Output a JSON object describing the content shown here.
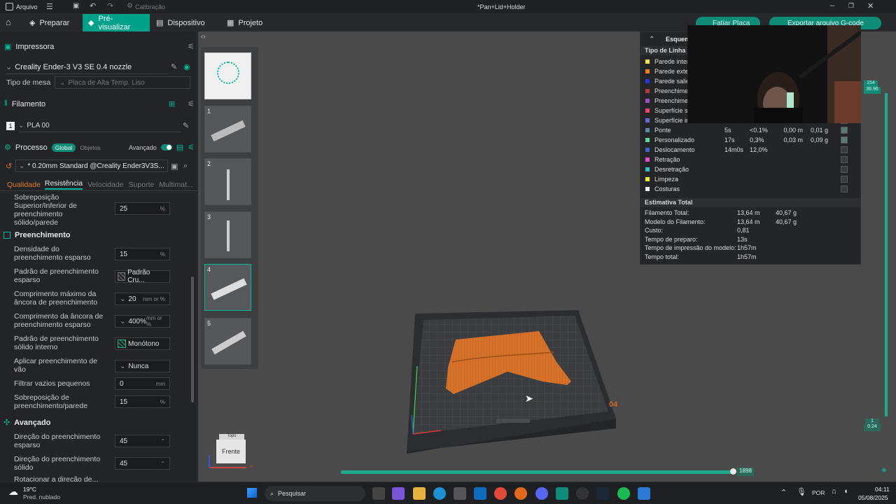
{
  "titlebar": {
    "file_menu": "Arquivo",
    "calibration": "Calibração",
    "doc_title": "*Pan+Lid+Holder"
  },
  "tabs": {
    "prepare": "Preparar",
    "preview": "Pré-visualizar",
    "device": "Dispositivo",
    "project": "Projeto",
    "slice": "Fatiar Placa",
    "export": "Exportar arquivo G-code"
  },
  "printer": {
    "section": "Impressora",
    "name": "Creality Ender-3 V3 SE 0.4 nozzle",
    "bed_label": "Tipo de mesa",
    "bed_value": "Placa de Alta Temp. Liso"
  },
  "filament": {
    "section": "Filamento",
    "slot": "1",
    "name": "PLA 00"
  },
  "process": {
    "section": "Processo",
    "global_tab": "Global",
    "objects_tab": "Objetos",
    "advanced_label": "Avançado",
    "profile": "* 0.20mm Standard @Creality Ender3V3S...",
    "subtabs": [
      "Qualidade",
      "Resistência",
      "Velocidade",
      "Suporte",
      "Multimat..."
    ]
  },
  "settings": {
    "overlap_label": "Sobreposição Superior/Inferior de preenchimento sólido/parede",
    "overlap_value": "25",
    "overlap_unit": "%",
    "infill_section": "Preenchimento",
    "density_label": "Densidade do preenchimento esparso",
    "density_value": "15",
    "density_unit": "%",
    "sparse_pattern_label": "Padrão de preenchimento esparso",
    "sparse_pattern_value": "Padrão Cru...",
    "anchor_max_label": "Comprimento máximo da âncora de preenchimento",
    "anchor_max_value": "20",
    "anchor_max_unit": "mm or %",
    "anchor_len_label": "Comprimento da âncora de preenchimento esparso",
    "anchor_len_value": "400%",
    "anchor_len_unit": "mm or %",
    "solid_pattern_label": "Padrão de preenchimento sólido interno",
    "solid_pattern_value": "Monótono",
    "apply_gap_label": "Aplicar preenchimento de vão",
    "apply_gap_value": "Nunca",
    "filter_label": "Filtrar vazios pequenos",
    "filter_value": "0",
    "filter_unit": "mm",
    "wall_overlap_label": "Sobreposição de preenchimento/parede",
    "wall_overlap_value": "15",
    "wall_overlap_unit": "%",
    "advanced_section": "Avançado",
    "sparse_dir_label": "Direção do preenchimento esparso",
    "sparse_dir_value": "45",
    "solid_dir_label": "Direção do preenchimento sólido",
    "solid_dir_value": "45",
    "cut_label": "Rotacionar a direção de..."
  },
  "plates": [
    "1",
    "2",
    "3",
    "4",
    "5"
  ],
  "viewcube": {
    "face": "Frente",
    "top": "Topo"
  },
  "layer_slider": {
    "top": "154",
    "top_height": "36.96",
    "bottom": "1",
    "bottom_height": "0.24"
  },
  "move_slider": {
    "value": "1898"
  },
  "legend": {
    "title": "Esquema",
    "header": "Tipo de Linha",
    "rows": [
      {
        "name": "Parede inter",
        "color": "#f4e34c",
        "time": "",
        "pct": "",
        "len": "",
        "wt": "",
        "chk": false
      },
      {
        "name": "Parede exter",
        "color": "#f47a1f",
        "time": "",
        "pct": "",
        "len": "",
        "wt": "",
        "chk": false
      },
      {
        "name": "Parede salie",
        "color": "#2b34d9",
        "time": "",
        "pct": "",
        "len": "",
        "wt": "",
        "chk": false
      },
      {
        "name": "Preenchimer",
        "color": "#b03b3b",
        "time": "",
        "pct": "",
        "len": "",
        "wt": "",
        "chk": false
      },
      {
        "name": "Preenchimer",
        "color": "#9a4fc5",
        "time": "",
        "pct": "",
        "len": "",
        "wt": "",
        "chk": false
      },
      {
        "name": "Superfície su",
        "color": "#e8456a",
        "time": "",
        "pct": "",
        "len": "",
        "wt": "",
        "chk": false
      },
      {
        "name": "Superfície in",
        "color": "#6a6adb",
        "time": "",
        "pct": "",
        "len": "",
        "wt": "",
        "chk": false
      },
      {
        "name": "Ponte",
        "color": "#5c8aa6",
        "time": "5s",
        "pct": "<0.1%",
        "len": "0,00 m",
        "wt": "0,01 g",
        "chk": true
      },
      {
        "name": "Personalizado",
        "color": "#5fd99a",
        "time": "17s",
        "pct": "0,3%",
        "len": "0,03 m",
        "wt": "0,09 g",
        "chk": true
      },
      {
        "name": "Deslocamento",
        "color": "#3f66c4",
        "time": "14m0s",
        "pct": "12,0%",
        "len": "",
        "wt": "",
        "chk": false
      },
      {
        "name": "Retração",
        "color": "#e34ad3",
        "time": "",
        "pct": "",
        "len": "",
        "wt": "",
        "chk": false
      },
      {
        "name": "Desretração",
        "color": "#33c4c9",
        "time": "",
        "pct": "",
        "len": "",
        "wt": "",
        "chk": false
      },
      {
        "name": "Limpeza",
        "color": "#f2ef3a",
        "time": "",
        "pct": "",
        "len": "",
        "wt": "",
        "chk": false
      },
      {
        "name": "Costuras",
        "color": "#eeeeee",
        "time": "",
        "pct": "",
        "len": "",
        "wt": "",
        "chk": false
      }
    ],
    "totals_header": "Estimativa Total",
    "totals": [
      {
        "label": "Filamento Total:",
        "v1": "13,64 m",
        "v2": "40,67 g"
      },
      {
        "label": "Modelo do Filamento:",
        "v1": "13,64 m",
        "v2": "40,67 g"
      },
      {
        "label": "Custo:",
        "v1": "0,81",
        "v2": ""
      },
      {
        "label": "Tempo de preparo:",
        "v1": "13s",
        "v2": ""
      },
      {
        "label": "Tempo de impressão do modelo:",
        "v1": "1h57m",
        "v2": ""
      },
      {
        "label": "Tempo total:",
        "v1": "1h57m",
        "v2": ""
      }
    ]
  },
  "plate_label": "04",
  "taskbar": {
    "temp": "19°C",
    "weather": "Pred. nublado",
    "search": "Pesquisar",
    "lang": "POR",
    "time": "04:11",
    "date": "05/08/2025"
  },
  "colors": {
    "accent": "#00a18a",
    "model": "#e07a2c"
  }
}
